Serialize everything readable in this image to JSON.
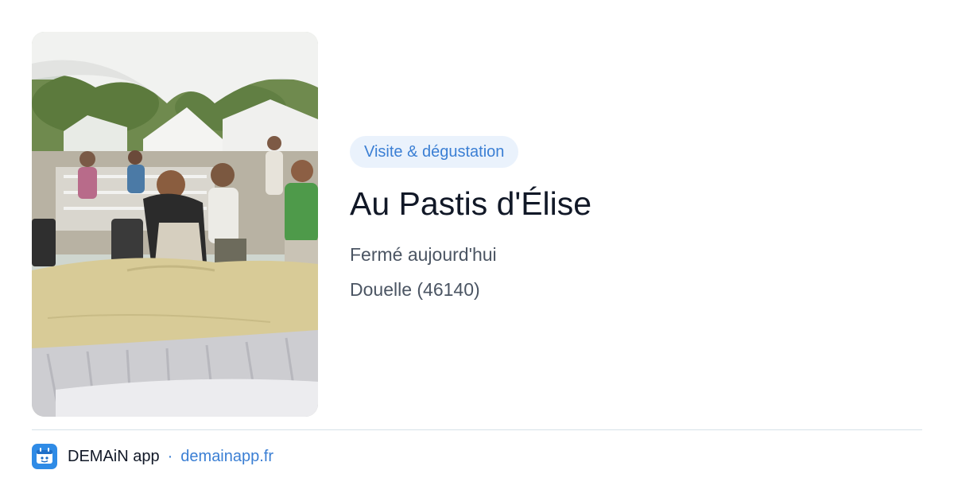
{
  "listing": {
    "photo_icon": "market-event-photo",
    "tag": "Visite & dégustation",
    "title": "Au Pastis d'Élise",
    "status": "Fermé aujourd'hui",
    "location": "Douelle (46140)"
  },
  "footer": {
    "app_icon": "demain-app-logo-icon",
    "app_name": "DEMAiN app",
    "separator": "·",
    "domain": "demainapp.fr"
  },
  "colors": {
    "accent": "#3b7fd4",
    "tag_background": "#eaf2fc",
    "title": "#111827",
    "secondary_text": "#4b5563",
    "divider": "#d6e2e8",
    "app_icon_background": "#2f8be6"
  }
}
